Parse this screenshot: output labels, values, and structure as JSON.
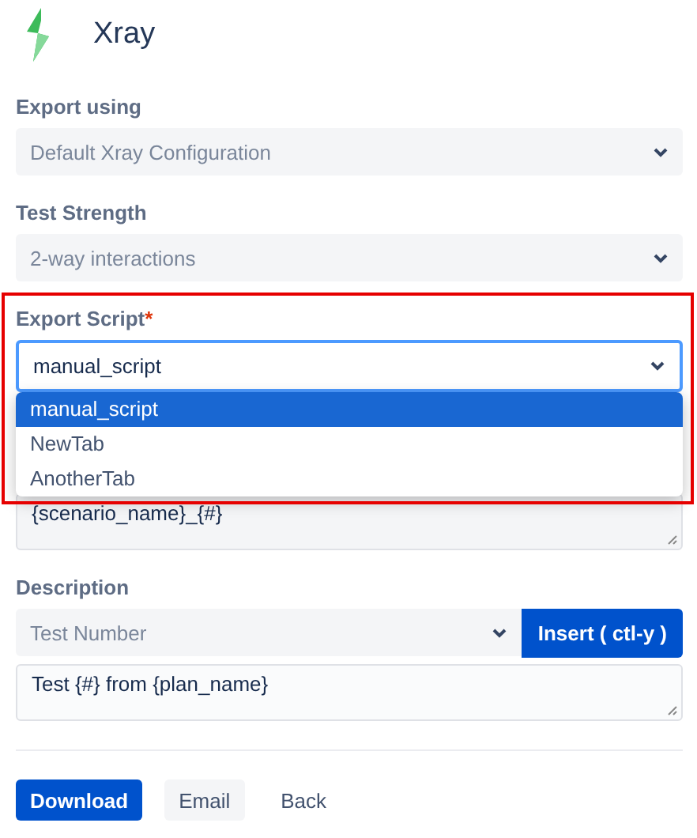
{
  "app": {
    "title": "Xray"
  },
  "fields": [
    {
      "label": "Export using",
      "value": "Default Xray Configuration"
    },
    {
      "label": "Test Strength",
      "value": "2-way interactions"
    }
  ],
  "export_script": {
    "label": "Export Script",
    "required_mark": "*",
    "value": "manual_script",
    "options": [
      {
        "label": "manual_script",
        "selected": true
      },
      {
        "label": "NewTab",
        "selected": false
      },
      {
        "label": "AnotherTab",
        "selected": false
      }
    ]
  },
  "name_template": {
    "value": "{scenario_name}_{#}"
  },
  "description": {
    "label": "Description",
    "variable": "Test Number",
    "insert_button": "Insert ( ctl-y )",
    "value": "Test {#} from {plan_name}"
  },
  "buttons": [
    {
      "label": "Download",
      "kind": "primary"
    },
    {
      "label": "Email",
      "kind": "secondary"
    },
    {
      "label": "Back",
      "kind": "link"
    }
  ]
}
